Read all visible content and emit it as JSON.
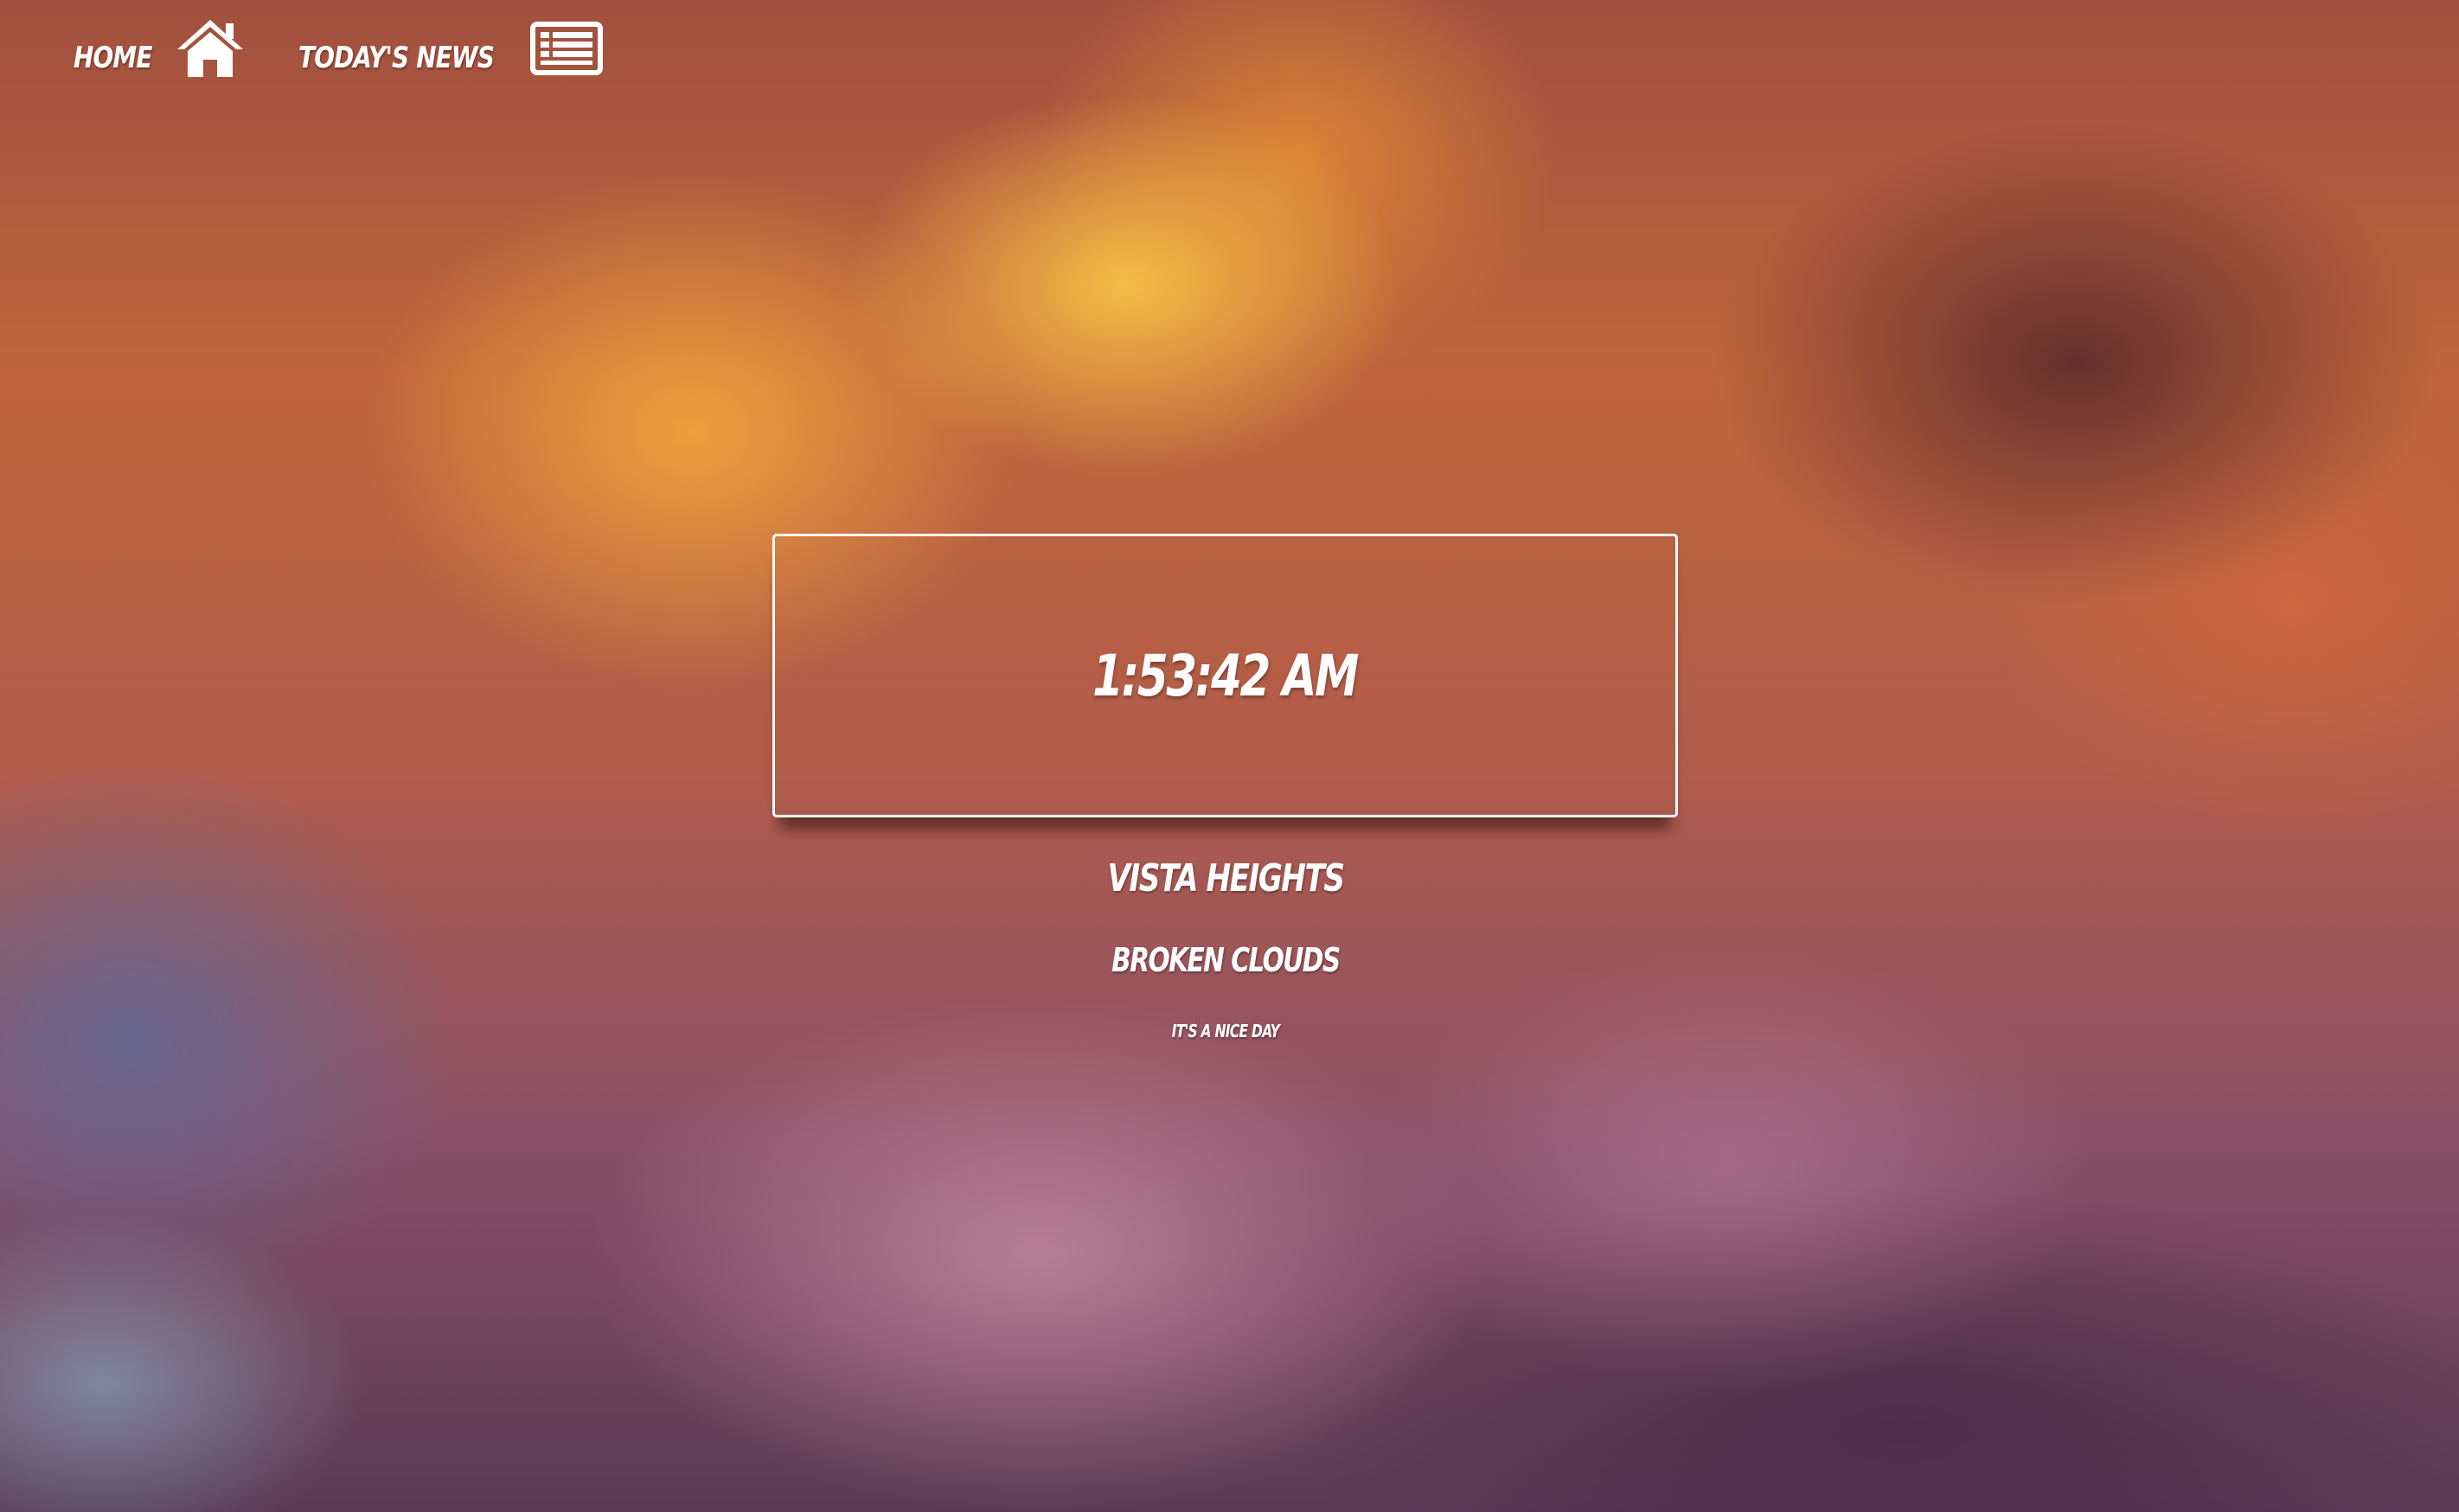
{
  "nav": {
    "home_label": "Home",
    "home_icon": "home-icon",
    "news_label": "Today's News",
    "news_icon": "newspaper-icon"
  },
  "clock": {
    "time": "1:53:42 AM"
  },
  "weather": {
    "location": "Vista Heights",
    "condition": "Broken Clouds",
    "message": "It's a nice day"
  },
  "colors": {
    "text": "#ffffff",
    "border": "#ffffff"
  }
}
